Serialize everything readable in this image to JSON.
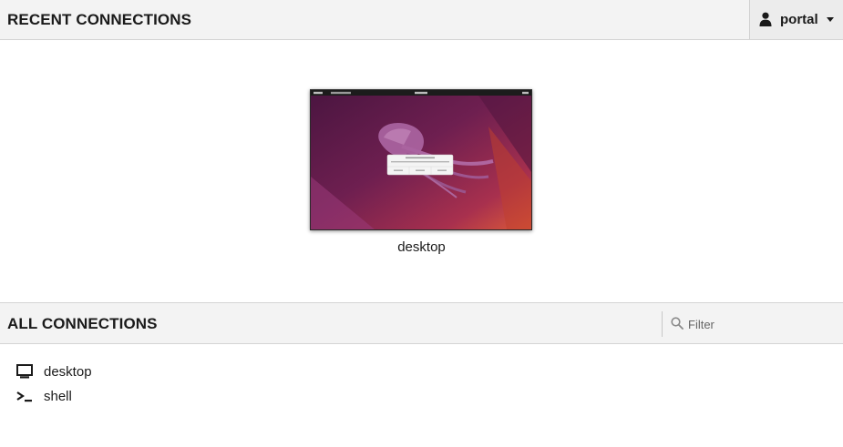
{
  "recent": {
    "title": "RECENT CONNECTIONS",
    "items": [
      {
        "label": "desktop"
      }
    ]
  },
  "user_menu": {
    "username": "portal",
    "icon": "user-icon",
    "caret_icon": "caret-down-icon"
  },
  "all": {
    "title": "ALL CONNECTIONS",
    "filter": {
      "placeholder": "Filter",
      "value": "",
      "icon": "search-icon"
    },
    "items": [
      {
        "label": "desktop",
        "icon": "monitor-icon"
      },
      {
        "label": "shell",
        "icon": "terminal-icon"
      }
    ]
  },
  "colors": {
    "header_bg": "#f3f3f3",
    "border": "#d4d4d4",
    "text": "#1a1a1a",
    "wallpaper_dark": "#5a1a4a",
    "wallpaper_orange": "#d8523a"
  }
}
